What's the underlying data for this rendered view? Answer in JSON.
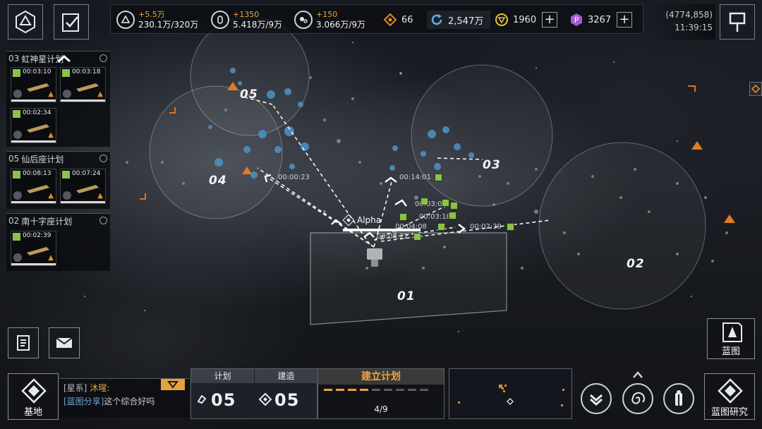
{
  "topbar": {
    "resources": [
      {
        "name": "metal",
        "icon": "triangle-ore-icon",
        "delta": "+5.5万",
        "amount": "230.1万/320万"
      },
      {
        "name": "crystal",
        "icon": "crystal-icon",
        "delta": "+1350",
        "amount": "5.418万/9万"
      },
      {
        "name": "deuterium",
        "icon": "gas-icon",
        "delta": "+150",
        "amount": "3.066万/9万"
      }
    ],
    "compute": "66",
    "credits": "2,547万",
    "gold": "1960",
    "premium": "3267"
  },
  "location": {
    "coords": "(4774,858)",
    "time": "11:39:15"
  },
  "plans": [
    {
      "num": "03",
      "name": "虹神星计划",
      "ships": [
        {
          "timer": "00:03:10"
        },
        {
          "timer": "00:03:18"
        },
        {
          "timer": "00:02:34"
        }
      ]
    },
    {
      "num": "05",
      "name": "仙后座计划",
      "ships": [
        {
          "timer": "00:08:13"
        },
        {
          "timer": "00:07:24"
        }
      ]
    },
    {
      "num": "02",
      "name": "南十字座计划",
      "ships": [
        {
          "timer": "00:02:39"
        }
      ]
    }
  ],
  "map": {
    "zones": [
      "01",
      "02",
      "03",
      "04",
      "05"
    ],
    "base_name": "Alpha",
    "timers": {
      "t1": "00:00:23",
      "t2": "00:14:01",
      "t3": "00:03:09",
      "t4": "00:03:18",
      "t5": "00:02:39",
      "t6": "00:08:22",
      "t7": "00:04:08"
    }
  },
  "bottom": {
    "base_label": "基地",
    "chat": {
      "channel": "[星系]",
      "sender": "沐瑆:",
      "link": "[蓝图分享]",
      "message": "这个综合好吗"
    },
    "plan_header": "计划",
    "build_header": "建造",
    "plan_count": "05",
    "build_count": "05",
    "create_plan": "建立计划",
    "progress": "4/9",
    "blueprint_label": "蓝图",
    "research_label": "蓝图研究"
  },
  "colors": {
    "accent": "#e6a23a",
    "tag_green": "#8bc24a",
    "asteroid_blue": "#5aa6d6"
  }
}
